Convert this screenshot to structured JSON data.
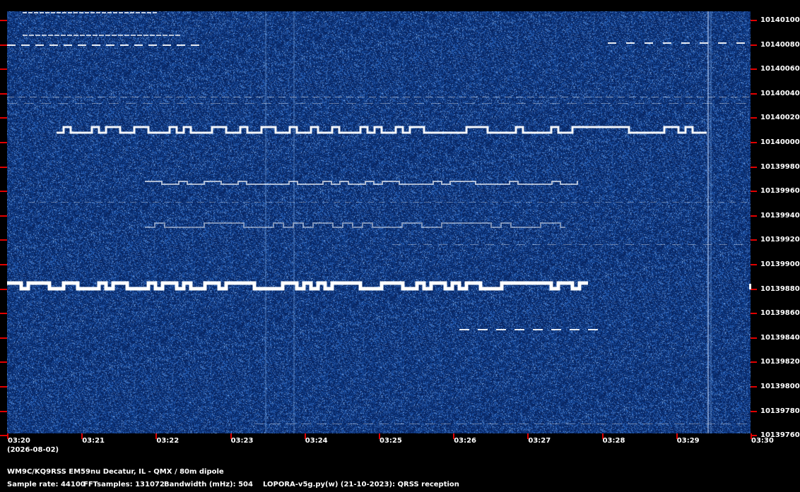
{
  "spectrogram": {
    "background_color": "#0b2a66",
    "noise_color": "#3a6fc0",
    "signal_color": "#ffffff"
  },
  "freq_axis": {
    "labels": [
      "10140100",
      "10140080",
      "10140060",
      "10140040",
      "10140020",
      "10140000",
      "10139980",
      "10139960",
      "10139940",
      "10139920",
      "10139900",
      "10139880",
      "10139860",
      "10139840",
      "10139820",
      "10139800",
      "10139780",
      "10139760"
    ]
  },
  "time_axis": {
    "labels": [
      "03:20",
      "03:21",
      "03:22",
      "03:23",
      "03:24",
      "03:25",
      "03:26",
      "03:27",
      "03:28",
      "03:29",
      "03:30"
    ],
    "date": "(2026-08-02)"
  },
  "footer": {
    "station": "WM9C/KQ9RSS EM59nu Decatur, IL - QMX / 80m dipole",
    "sample_rate": "Sample rate: 44100",
    "fft_samples": "FFTsamples: 131072",
    "bandwidth": "Bandwidth (mHz): 504",
    "software": "LOPORA-v5g.py(w) (21-10-2023): QRSS reception"
  },
  "marker_color": "#e00000"
}
